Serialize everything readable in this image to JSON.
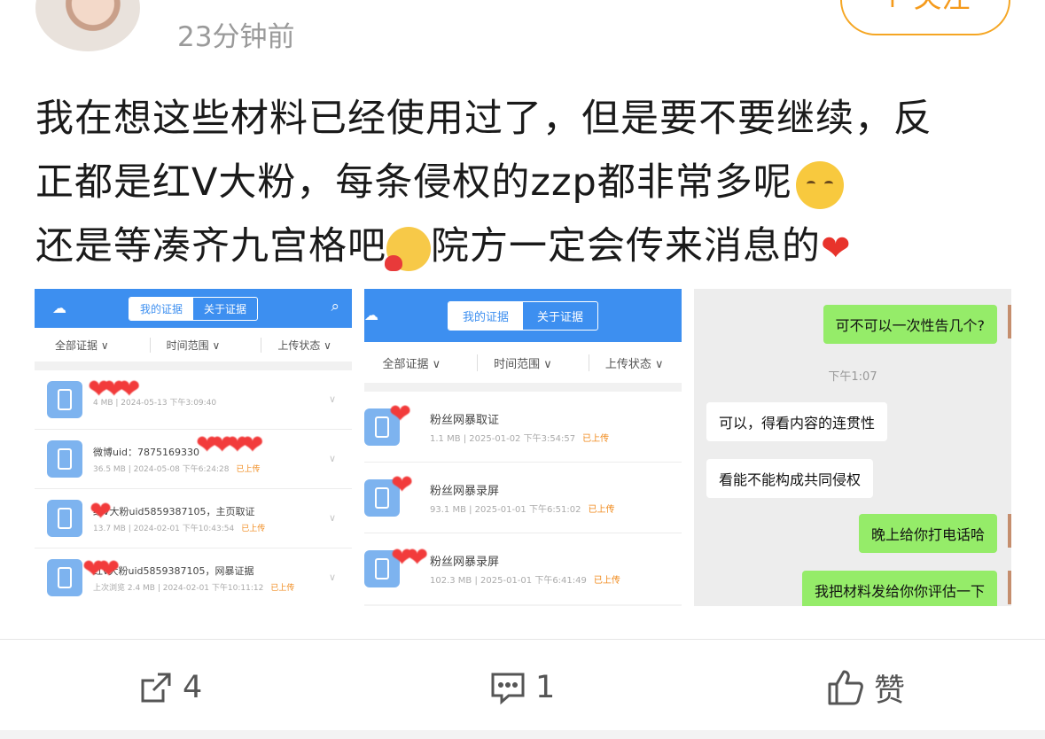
{
  "header": {
    "time": "23分钟前",
    "follow_label": "+ 关注"
  },
  "post": {
    "line1": "我在想这些材料已经使用过了，但是要不要继续，反",
    "line2": "正都是红V大粉，每条侵权的zzp都非常多呢",
    "line3a": "还是等凑齐九宫格吧",
    "line3b": "院方一定会传来消息的"
  },
  "image1": {
    "tab_active": "我的证据",
    "tab_other": "关于证据",
    "filters": [
      "全部证据 ∨",
      "时间范围 ∨",
      "上传状态 ∨"
    ],
    "items": [
      {
        "title": "",
        "meta": "4 MB | 2024-05-13 下午3:09:40",
        "status": ""
      },
      {
        "title": "微博uid：7875169330",
        "meta": "36.5 MB | 2024-05-08 下午6:24:28",
        "status": "已上传"
      },
      {
        "title": "红V大粉uid5859387105，主页取证",
        "meta": "13.7 MB | 2024-02-01 下午10:43:54",
        "status": "已上传"
      },
      {
        "title": "红v大粉uid5859387105，网暴证据",
        "meta": "上次浏览  2.4 MB | 2024-02-01 下午10:11:12",
        "status": "已上传"
      }
    ]
  },
  "image2": {
    "tab_active": "我的证据",
    "tab_other": "关于证据",
    "filters": [
      "全部证据 ∨",
      "时间范围 ∨",
      "上传状态 ∨"
    ],
    "items": [
      {
        "title": "粉丝网暴取证",
        "meta": "1.1 MB | 2025-01-02 下午3:54:57",
        "status": "已上传"
      },
      {
        "title": "粉丝网暴录屏",
        "meta": "93.1 MB | 2025-01-01 下午6:51:02",
        "status": "已上传"
      },
      {
        "title": "粉丝网暴录屏",
        "meta": "102.3 MB | 2025-01-01 下午6:41:49",
        "status": "已上传"
      }
    ]
  },
  "image3": {
    "msg1": "可不可以一次性告几个?",
    "time": "下午1:07",
    "msg2": "可以，得看内容的连贯性",
    "msg3": "看能不能构成共同侵权",
    "msg4": "晚上给你打电话哈",
    "msg5": "我把材料发给你你评估一下"
  },
  "actions": {
    "share_count": "4",
    "comment_count": "1",
    "like_label": "赞"
  },
  "colors": {
    "accent": "#f5a623",
    "app_blue": "#3d8ff0",
    "wechat_green": "#95ec69"
  }
}
